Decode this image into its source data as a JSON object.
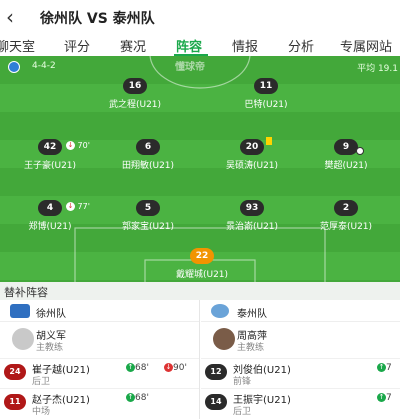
{
  "header": {
    "title": "徐州队 VS 泰州队",
    "back_icon": "chevron-left-icon"
  },
  "tabs": [
    {
      "label": "聊天室"
    },
    {
      "label": "评分"
    },
    {
      "label": "赛况"
    },
    {
      "label": "阵容",
      "active": true
    },
    {
      "label": "情报"
    },
    {
      "label": "分析"
    },
    {
      "label": "专属网站"
    }
  ],
  "pitch": {
    "watermark": "懂球帝",
    "formation": "4-4-2",
    "avg_age": "平均 19.1",
    "colors": {
      "grass": "#43a83a",
      "stripe": "#4bb342",
      "goalkeeper": "#f29400",
      "player": "#2b2b2b"
    },
    "players": [
      {
        "number": "16",
        "name": "武之程(U21)"
      },
      {
        "number": "11",
        "name": "巴特(U21)"
      },
      {
        "number": "42",
        "name": "王子豪(U21)",
        "event": "70'"
      },
      {
        "number": "6",
        "name": "田翔敏(U21)"
      },
      {
        "number": "20",
        "name": "吴硕涛(U21)"
      },
      {
        "number": "9",
        "name": "樊超(U21)"
      },
      {
        "number": "4",
        "name": "郑博(U21)",
        "event": "77'"
      },
      {
        "number": "5",
        "name": "郭家宝(U21)"
      },
      {
        "number": "93",
        "name": "景治嵛(U21)"
      },
      {
        "number": "2",
        "name": "范厚泰(U21)"
      },
      {
        "number": "22",
        "name": "戴耀城(U21)"
      }
    ]
  },
  "subs": {
    "title": "替补阵容",
    "left": {
      "team": "徐州队",
      "coach": {
        "name": "胡义军",
        "role": "主教练"
      },
      "players": [
        {
          "number": "24",
          "name": "崔子越(U21)",
          "position": "后卫",
          "in": "68'",
          "out": "90'"
        },
        {
          "number": "11",
          "name": "赵子杰(U21)",
          "position": "中场",
          "in": "68'"
        }
      ]
    },
    "right": {
      "team": "泰州队",
      "coach": {
        "name": "周高萍",
        "role": "主教练"
      },
      "players": [
        {
          "number": "12",
          "name": "刘俊伯(U21)",
          "position": "前锋",
          "in": "7"
        },
        {
          "number": "14",
          "name": "王振宇(U21)",
          "position": "后卫",
          "in": "7"
        }
      ]
    }
  }
}
